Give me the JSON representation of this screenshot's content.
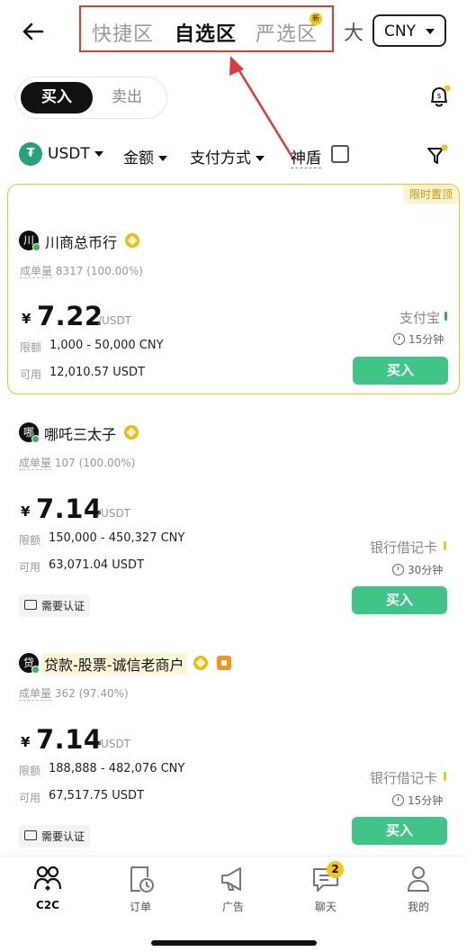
{
  "header": {
    "tabs": [
      {
        "label": "快捷区",
        "active": false
      },
      {
        "label": "自选区",
        "active": true
      },
      {
        "label": "严选区",
        "active": false,
        "badge": "新"
      }
    ],
    "size_label": "大",
    "currency": "CNY"
  },
  "trade_toggle": {
    "buy": "买入",
    "sell": "卖出"
  },
  "filters": {
    "coin": "USDT",
    "coin_icon_glyph": "₮",
    "amount": "金额",
    "payment": "支付方式",
    "shield": "神盾"
  },
  "ads": [
    {
      "pinned_tag": "限时置顶",
      "avatar": "川",
      "merchant": "川商总币行",
      "stats_label": "成单量",
      "stats_value": "8317 (100.00%)",
      "currency_symbol": "¥",
      "price": "7.22",
      "unit": "/USDT",
      "limit_label": "限额",
      "limit_value": "1,000 - 50,000 CNY",
      "available_label": "可用",
      "available_value": "12,010.57 USDT",
      "payment": "支付宝",
      "payment_color": "#3b8beb",
      "time": "15分钟",
      "button": "买入"
    },
    {
      "avatar": "哪",
      "merchant": "哪吒三太子",
      "stats_label": "成单量",
      "stats_value": "107 (100.00%)",
      "currency_symbol": "¥",
      "price": "7.14",
      "unit": "/USDT",
      "limit_label": "限额",
      "limit_value": "150,000 - 450,327 CNY",
      "available_label": "可用",
      "available_value": "63,071.04 USDT",
      "payment": "银行借记卡",
      "payment_color": "#f0c419",
      "time": "30分钟",
      "verify": "需要认证",
      "button": "买入"
    },
    {
      "avatar": "贷",
      "merchant": "贷款-股票-诚信老商户",
      "stats_label": "成单量",
      "stats_value": "362 (97.40%)",
      "currency_symbol": "¥",
      "price": "7.14",
      "unit": "/USDT",
      "limit_label": "限额",
      "limit_value": "188,888 - 482,076 CNY",
      "available_label": "可用",
      "available_value": "67,517.75 USDT",
      "payment": "银行借记卡",
      "payment_color": "#f0c419",
      "time": "15分钟",
      "verify": "需要认证",
      "button": "买入"
    }
  ],
  "bottom_nav": {
    "items": [
      {
        "label": "C2C",
        "icon": "people-icon",
        "active": true
      },
      {
        "label": "订单",
        "icon": "order-icon",
        "active": false
      },
      {
        "label": "广告",
        "icon": "megaphone-icon",
        "active": false
      },
      {
        "label": "聊天",
        "icon": "chat-icon",
        "active": false,
        "badge": "2"
      },
      {
        "label": "我的",
        "icon": "profile-icon",
        "active": false
      }
    ]
  }
}
